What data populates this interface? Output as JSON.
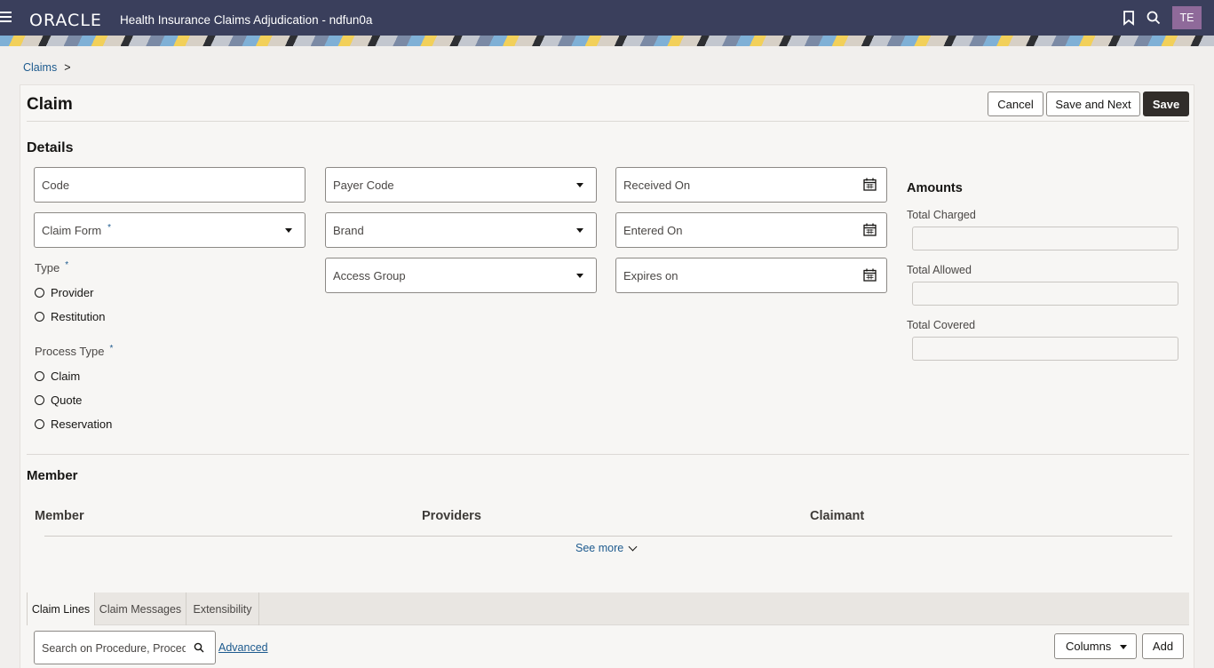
{
  "header": {
    "logo": "ORACLE",
    "title": "Health Insurance Claims Adjudication - ndfun0a",
    "user_initials": "TE",
    "colors": {
      "bar": "#3a3f5c",
      "avatar": "#8f6a9a"
    },
    "icons": [
      "hamburger-menu-icon",
      "bookmark-icon",
      "search-icon"
    ]
  },
  "breadcrumb": {
    "link": "Claims",
    "separator": ">"
  },
  "page": {
    "title": "Claim",
    "buttons": {
      "cancel": "Cancel",
      "save_next": "Save and Next",
      "save": "Save"
    }
  },
  "details": {
    "heading": "Details",
    "code": "Code",
    "claim_form": "Claim Form",
    "required_mark": "*",
    "type_label": "Type",
    "type_options": [
      "Provider",
      "Restitution"
    ],
    "process_type_label": "Process Type",
    "process_options": [
      "Claim",
      "Quote",
      "Reservation"
    ],
    "payer_code": "Payer Code",
    "brand": "Brand",
    "access_group": "Access Group",
    "received_on": "Received On",
    "entered_on": "Entered On",
    "expires_on": "Expires on"
  },
  "amounts": {
    "heading": "Amounts",
    "total_charged": "Total Charged",
    "total_allowed": "Total Allowed",
    "total_covered": "Total Covered"
  },
  "member": {
    "heading": "Member",
    "columns": [
      "Member",
      "Providers",
      "Claimant"
    ],
    "see_more": "See more"
  },
  "tabs": [
    "Claim Lines",
    "Claim Messages",
    "Extensibility"
  ],
  "claim_lines": {
    "search_placeholder": "Search on Procedure, Procedure",
    "advanced": "Advanced",
    "columns_button": "Columns",
    "add_button": "Add"
  }
}
